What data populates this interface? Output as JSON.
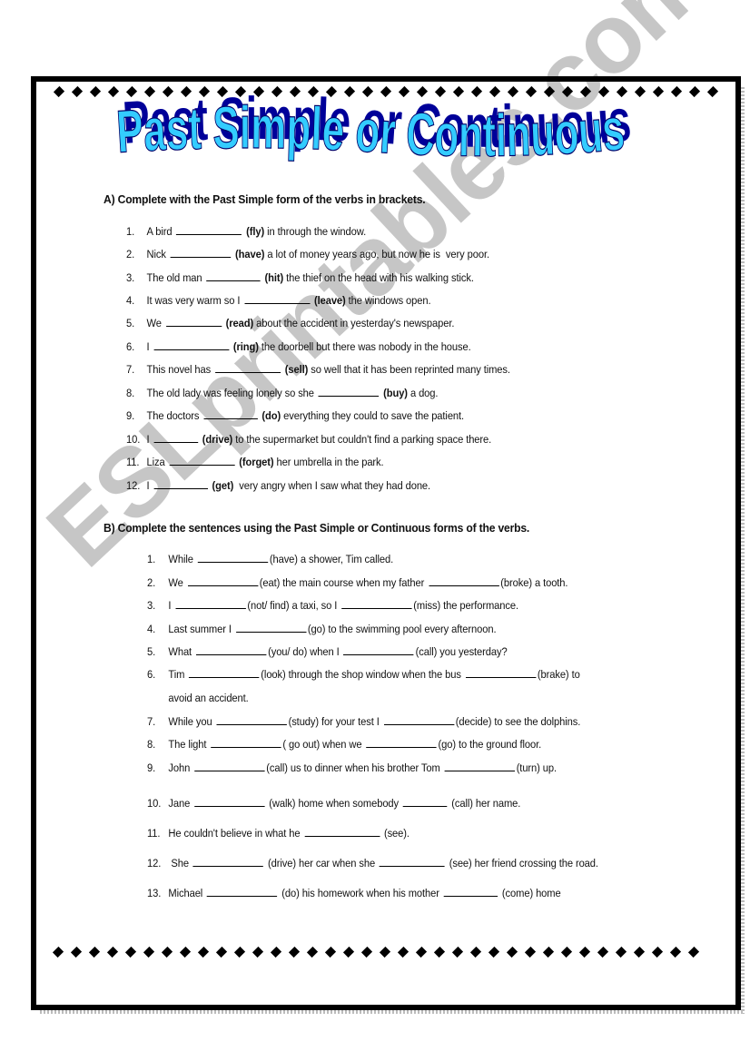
{
  "title": "Past Simple or Continuous",
  "watermark": "ESLprintables.com",
  "colors": {
    "title_fill": "#33ccff",
    "title_shadow": "#000099",
    "title_outline": "#000066",
    "watermark": "#c4c4c4",
    "border": "#000000"
  },
  "section_a": {
    "heading": "A) Complete with the Past Simple form of the verbs in brackets.",
    "items": [
      {
        "num": "1.",
        "parts": [
          {
            "t": "A bird "
          },
          {
            "blank": 80
          },
          {
            "b": " (fly)"
          },
          {
            "t": " in through the window."
          }
        ]
      },
      {
        "num": "2.",
        "parts": [
          {
            "t": "Nick "
          },
          {
            "blank": 74
          },
          {
            "b": " (have)"
          },
          {
            "t": " a lot of money years ago, but now he is  very poor."
          }
        ]
      },
      {
        "num": "3.",
        "parts": [
          {
            "t": "The old man "
          },
          {
            "blank": 66
          },
          {
            "b": " (hit)"
          },
          {
            "t": " the thief on the head with his walking stick."
          }
        ]
      },
      {
        "num": "4.",
        "parts": [
          {
            "t": "It was very warm so I "
          },
          {
            "blank": 80
          },
          {
            "b": " (leave)"
          },
          {
            "t": " the windows open."
          }
        ]
      },
      {
        "num": "5.",
        "parts": [
          {
            "t": "We "
          },
          {
            "blank": 68
          },
          {
            "b": " (read)"
          },
          {
            "t": " about the accident in yesterday's newspaper."
          }
        ]
      },
      {
        "num": "6.",
        "parts": [
          {
            "t": "I "
          },
          {
            "blank": 92
          },
          {
            "b": " (ring)"
          },
          {
            "t": " the doorbell but there was nobody in the house."
          }
        ]
      },
      {
        "num": "7.",
        "parts": [
          {
            "t": "This novel has "
          },
          {
            "blank": 80
          },
          {
            "b": " (sell)"
          },
          {
            "t": " so well that it has been reprinted many times."
          }
        ]
      },
      {
        "num": "8.",
        "parts": [
          {
            "t": "The old lady was feeling lonely so she "
          },
          {
            "blank": 74
          },
          {
            "b": " (buy)"
          },
          {
            "t": " a dog."
          }
        ]
      },
      {
        "num": "9.",
        "parts": [
          {
            "t": "The doctors "
          },
          {
            "blank": 66
          },
          {
            "b": " (do)"
          },
          {
            "t": " everything they could to save the patient."
          }
        ]
      },
      {
        "num": "10.",
        "parts": [
          {
            "t": "I "
          },
          {
            "blank": 54
          },
          {
            "b": " (drive)"
          },
          {
            "t": " to the supermarket but couldn't find a parking space there."
          }
        ]
      },
      {
        "num": "11.",
        "parts": [
          {
            "t": "Liza "
          },
          {
            "blank": 80
          },
          {
            "b": " (forget)"
          },
          {
            "t": " her umbrella in the park."
          }
        ]
      },
      {
        "num": "12.",
        "parts": [
          {
            "t": "I "
          },
          {
            "blank": 66
          },
          {
            "b": " (get)"
          },
          {
            "t": "  very angry when I saw what they had done."
          }
        ]
      }
    ]
  },
  "section_b": {
    "heading": "B) Complete the sentences using the Past Simple or Continuous forms of the verbs.",
    "items": [
      {
        "num": "1.",
        "parts": [
          {
            "t": "While "
          },
          {
            "blank": 86
          },
          {
            "t": "(have) a shower, Tim called."
          }
        ]
      },
      {
        "num": "2.",
        "parts": [
          {
            "t": "We "
          },
          {
            "blank": 86
          },
          {
            "t": "(eat) the main course when my father "
          },
          {
            "blank": 86
          },
          {
            "t": "(broke) a tooth."
          }
        ]
      },
      {
        "num": "3.",
        "parts": [
          {
            "t": "I "
          },
          {
            "blank": 86
          },
          {
            "t": "(not/ find) a taxi, so I "
          },
          {
            "blank": 86
          },
          {
            "t": "(miss) the performance."
          }
        ]
      },
      {
        "num": "4.",
        "parts": [
          {
            "t": "Last summer I "
          },
          {
            "blank": 86
          },
          {
            "t": "(go) to the swimming pool every afternoon."
          }
        ]
      },
      {
        "num": "5.",
        "parts": [
          {
            "t": "What "
          },
          {
            "blank": 86
          },
          {
            "t": "(you/ do) when I "
          },
          {
            "blank": 86
          },
          {
            "t": "(call) you yesterday?"
          }
        ]
      },
      {
        "num": "6.",
        "parts": [
          {
            "t": "Tim "
          },
          {
            "blank": 86
          },
          {
            "t": "(look) through the shop window when the bus "
          },
          {
            "blank": 86
          },
          {
            "t": "(brake) to"
          }
        ],
        "cont": "avoid an accident."
      },
      {
        "num": "7.",
        "parts": [
          {
            "t": "While you "
          },
          {
            "blank": 86
          },
          {
            "t": "(study) for your test I "
          },
          {
            "blank": 86
          },
          {
            "t": "(decide) to see the dolphins."
          }
        ]
      },
      {
        "num": "8.",
        "parts": [
          {
            "t": "The light "
          },
          {
            "blank": 86
          },
          {
            "t": "( go out) when we "
          },
          {
            "blank": 86
          },
          {
            "t": "(go) to the ground floor."
          }
        ]
      },
      {
        "num": "9.",
        "parts": [
          {
            "t": "John "
          },
          {
            "blank": 86
          },
          {
            "t": "(call) us to dinner when his brother Tom "
          },
          {
            "blank": 86
          },
          {
            "t": "(turn) up."
          }
        ]
      },
      {
        "num": "10.",
        "parts": [
          {
            "t": "Jane "
          },
          {
            "blank": 86
          },
          {
            "t": " (walk) home when somebody "
          },
          {
            "blank": 54
          },
          {
            "t": " (call) her name."
          }
        ]
      },
      {
        "num": "11.",
        "parts": [
          {
            "t": "He couldn't believe in what he "
          },
          {
            "blank": 92
          },
          {
            "t": " (see)."
          }
        ]
      },
      {
        "num": "12.",
        "parts": [
          {
            "t": " She "
          },
          {
            "blank": 86
          },
          {
            "t": " (drive) her car when she "
          },
          {
            "blank": 80
          },
          {
            "t": " (see) her friend crossing the road."
          }
        ]
      },
      {
        "num": "13.",
        "parts": [
          {
            "t": "Michael "
          },
          {
            "blank": 86
          },
          {
            "t": " (do) his homework when his mother "
          },
          {
            "blank": 66
          },
          {
            "t": " (come) home"
          }
        ]
      }
    ]
  }
}
